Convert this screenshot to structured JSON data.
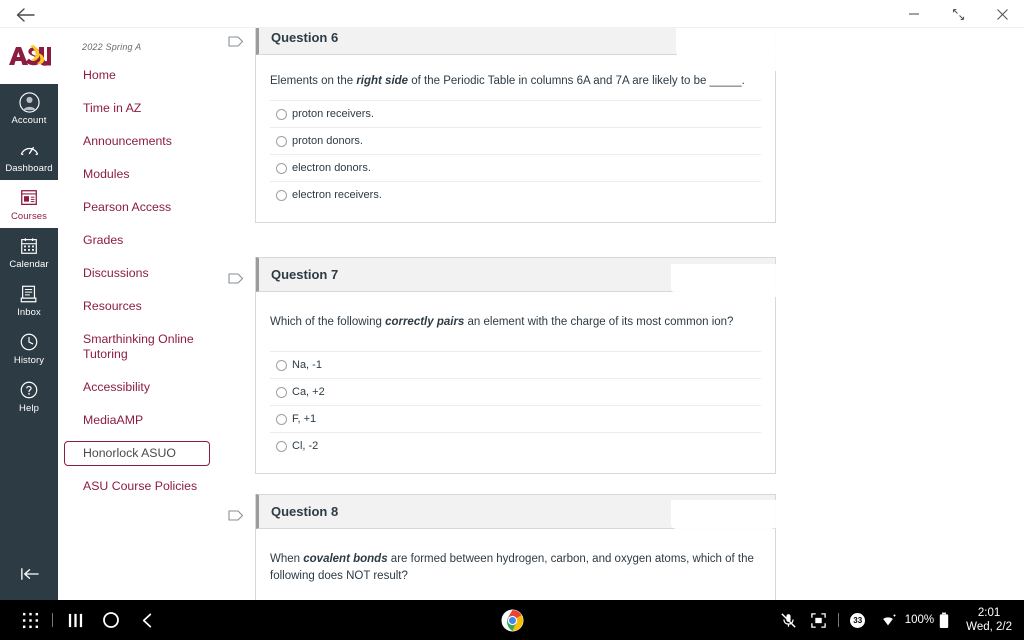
{
  "window": {
    "back_label": "back-arrow",
    "controls": [
      {
        "name": "minimize",
        "glyph": "—"
      },
      {
        "name": "restore",
        "glyph": "restore"
      },
      {
        "name": "close",
        "glyph": "✕"
      }
    ]
  },
  "global_nav": {
    "logo_alt": "ASU",
    "items": [
      {
        "label": "Account",
        "icon": "account-icon",
        "active": false
      },
      {
        "label": "Dashboard",
        "icon": "dashboard-icon",
        "active": false
      },
      {
        "label": "Courses",
        "icon": "courses-icon",
        "active": true
      },
      {
        "label": "Calendar",
        "icon": "calendar-icon",
        "active": false
      },
      {
        "label": "Inbox",
        "icon": "inbox-icon",
        "active": false
      },
      {
        "label": "History",
        "icon": "history-icon",
        "active": false
      },
      {
        "label": "Help",
        "icon": "help-icon",
        "active": false
      }
    ],
    "collapse_label": "collapse-nav"
  },
  "course_nav": {
    "term": "2022 Spring A",
    "items": [
      {
        "label": "Home",
        "focused": false
      },
      {
        "label": "Time in AZ",
        "focused": false
      },
      {
        "label": "Announcements",
        "focused": false
      },
      {
        "label": "Modules",
        "focused": false
      },
      {
        "label": "Pearson Access",
        "focused": false
      },
      {
        "label": "Grades",
        "focused": false
      },
      {
        "label": "Discussions",
        "focused": false
      },
      {
        "label": "Resources",
        "focused": false
      },
      {
        "label": "Smarthinking Online Tutoring",
        "focused": false
      },
      {
        "label": "Accessibility",
        "focused": false
      },
      {
        "label": "MediaAMP",
        "focused": false
      },
      {
        "label": "Honorlock ASUO",
        "focused": true
      },
      {
        "label": "ASU Course Policies",
        "focused": false
      }
    ]
  },
  "quiz": {
    "questions": [
      {
        "title": "Question 6",
        "prompt_pre": "Elements on the ",
        "prompt_em": "right side",
        "prompt_post": " of the Periodic Table in columns 6A and 7A are likely to be _____.",
        "answers": [
          "proton receivers.",
          "proton donors.",
          "electron donors.",
          "electron receivers."
        ]
      },
      {
        "title": "Question 7",
        "prompt_pre": "Which of the following ",
        "prompt_em": "correctly pairs",
        "prompt_post": " an element with the charge of its most common ion?",
        "answers": [
          "Na, -1",
          "Ca, +2",
          "F, +1",
          "Cl, -2"
        ]
      },
      {
        "title": "Question 8",
        "prompt_pre": "When ",
        "prompt_em": "covalent bonds",
        "prompt_post": " are formed between hydrogen, carbon, and oxygen atoms, which of the following does NOT result?",
        "answers": []
      }
    ]
  },
  "taskbar": {
    "left_buttons": [
      {
        "name": "app-drawer",
        "icon": "grid-dots-icon"
      },
      {
        "name": "recent-apps",
        "icon": "recents-icon"
      },
      {
        "name": "home",
        "icon": "circle-icon"
      },
      {
        "name": "back",
        "icon": "chevron-left-icon"
      }
    ],
    "center_app": {
      "name": "chrome",
      "label": "Google Chrome"
    },
    "status": {
      "mute_icon": "mic-muted-icon",
      "screenshot_icon": "screen-capture-icon",
      "notification_count": "33",
      "wifi_icon": "wifi-icon",
      "battery_percent": "100%",
      "battery_icon": "battery-full-icon",
      "time": "2:01",
      "date": "Wed, 2/2"
    }
  }
}
